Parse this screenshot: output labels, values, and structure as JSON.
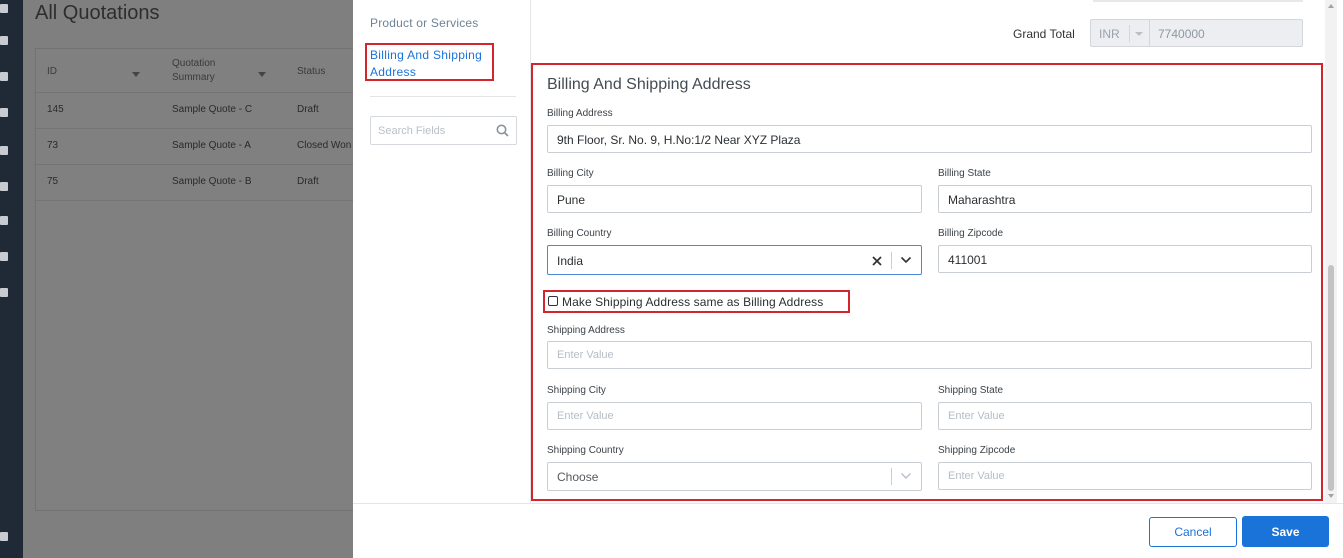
{
  "background": {
    "title": "All Quotations",
    "columns": [
      "ID",
      "Quotation Summary",
      "Status"
    ],
    "rows": [
      {
        "id": "145",
        "summary": "Sample Quote - C",
        "status": "Draft"
      },
      {
        "id": "73",
        "summary": "Sample Quote - A",
        "status": "Closed Won"
      },
      {
        "id": "75",
        "summary": "Sample Quote - B",
        "status": "Draft"
      }
    ]
  },
  "nav": {
    "items": [
      {
        "label": "Product or Services"
      },
      {
        "label": "Billing And Shipping Address"
      }
    ],
    "search_placeholder": "Search Fields"
  },
  "grand_total": {
    "label": "Grand Total",
    "currency": "INR",
    "value": "7740000"
  },
  "section": {
    "title": "Billing And Shipping Address",
    "billing_address": {
      "label": "Billing Address",
      "value": "9th Floor, Sr. No. 9, H.No:1/2 Near XYZ Plaza"
    },
    "billing_city": {
      "label": "Billing City",
      "value": "Pune"
    },
    "billing_state": {
      "label": "Billing State",
      "value": "Maharashtra"
    },
    "billing_country": {
      "label": "Billing Country",
      "value": "India"
    },
    "billing_zipcode": {
      "label": "Billing Zipcode",
      "value": "411001"
    },
    "same_as_billing": {
      "label": "Make Shipping Address same as Billing Address",
      "checked": false
    },
    "shipping_address": {
      "label": "Shipping Address",
      "placeholder": "Enter Value"
    },
    "shipping_city": {
      "label": "Shipping City",
      "placeholder": "Enter Value"
    },
    "shipping_state": {
      "label": "Shipping State",
      "placeholder": "Enter Value"
    },
    "shipping_country": {
      "label": "Shipping Country",
      "value": "Choose"
    },
    "shipping_zipcode": {
      "label": "Shipping Zipcode",
      "placeholder": "Enter Value"
    }
  },
  "footer": {
    "cancel_label": "Cancel",
    "save_label": "Save"
  },
  "colors": {
    "accent": "#1a73d9",
    "highlight": "#d4252f"
  }
}
